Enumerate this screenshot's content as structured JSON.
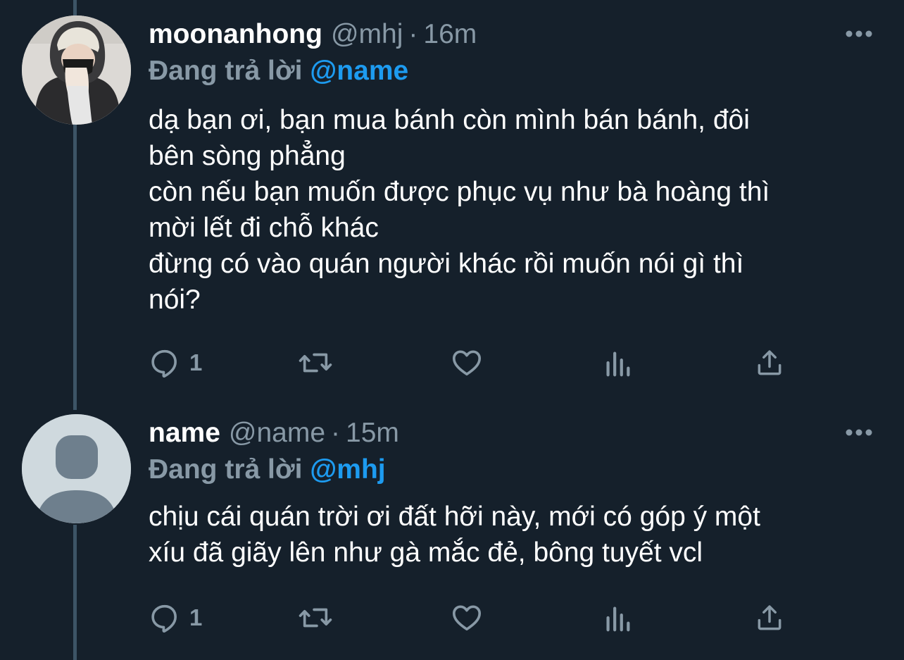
{
  "tweets": [
    {
      "display_name": "moonanhong",
      "handle": "@mhj",
      "separator": "·",
      "time": "16m",
      "reply_prefix": "Đang trả lời",
      "reply_to": "@name",
      "text_lines": [
        "dạ bạn ơi, bạn mua bánh còn mình bán bánh, đôi",
        "bên sòng phẳng",
        "còn nếu bạn muốn được phục vụ như bà hoàng thì",
        "mời lết đi chỗ khác",
        "đừng có vào quán người khác rồi muốn nói gì thì",
        "nói?"
      ],
      "reply_count": "1",
      "avatar": "profile-photo-hooded-person",
      "more_icon": "more-icon"
    },
    {
      "display_name": "name",
      "handle": "@name",
      "separator": "·",
      "time": "15m",
      "reply_prefix": "Đang trả lời",
      "reply_to": "@mhj",
      "text_lines": [
        "chịu cái quán trời ơi đất hỡi này, mới có góp ý một",
        "xíu đã giãy lên như gà mắc đẻ, bông tuyết vcl"
      ],
      "reply_count": "1",
      "avatar": "default-avatar",
      "more_icon": "more-icon"
    }
  ],
  "icons": {
    "reply": "reply-icon",
    "retweet": "retweet-icon",
    "like": "heart-icon",
    "views": "analytics-icon",
    "share": "share-icon"
  },
  "colors": {
    "background": "#15202b",
    "primary_text": "#ffffff",
    "secondary_text": "#8899a6",
    "accent": "#1d9bf0",
    "thread_line": "#3d5466"
  }
}
